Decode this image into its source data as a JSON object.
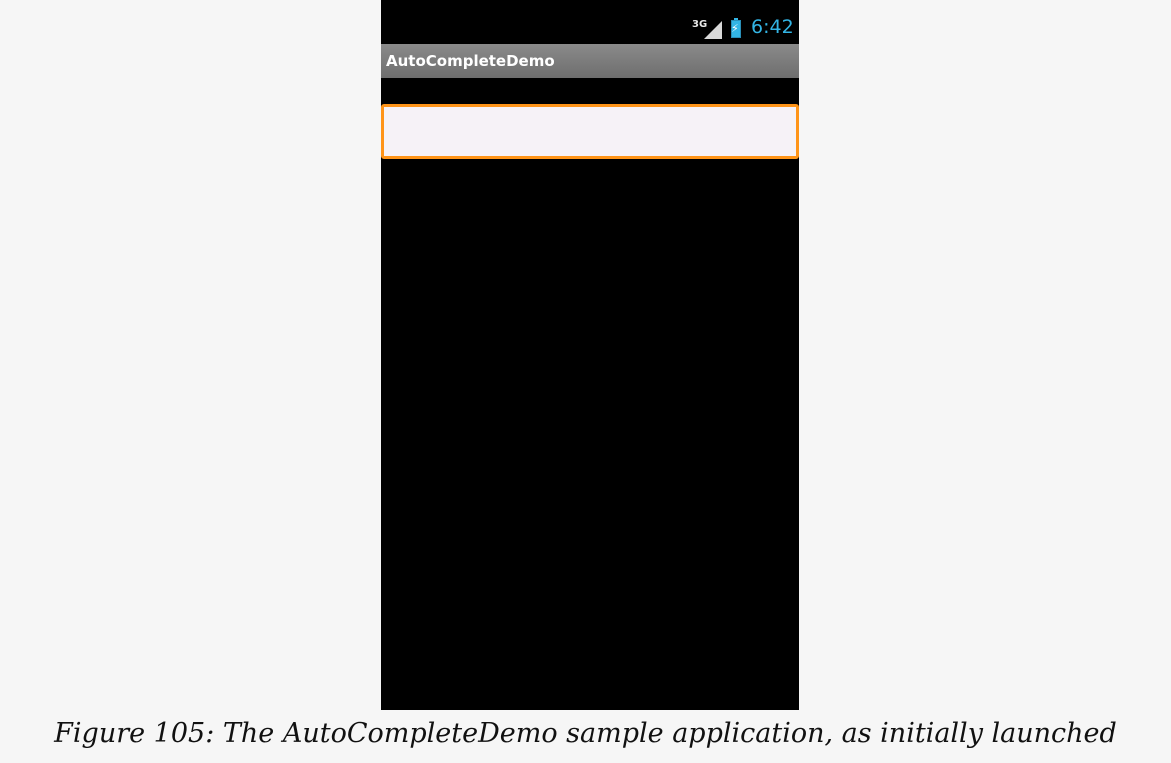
{
  "status_bar": {
    "network": "3G",
    "signal_icon": "signal-icon",
    "battery_icon": "battery-charging-icon",
    "time": "6:42",
    "time_color": "#33b5e5"
  },
  "app": {
    "title": "AutoCompleteDemo"
  },
  "input": {
    "value": "",
    "focus_color": "#ff9418"
  },
  "caption": {
    "text": "Figure 105: The AutoCompleteDemo sample application, as initially launched"
  }
}
